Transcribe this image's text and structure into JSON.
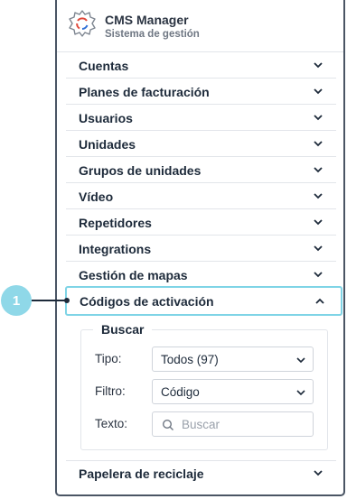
{
  "header": {
    "title": "CMS Manager",
    "subtitle": "Sistema de gestión",
    "logo_icon": "gear-logo-icon"
  },
  "menu": {
    "items": [
      {
        "label": "Cuentas"
      },
      {
        "label": "Planes de facturación"
      },
      {
        "label": "Usuarios"
      },
      {
        "label": "Unidades"
      },
      {
        "label": "Grupos de unidades"
      },
      {
        "label": "Vídeo"
      },
      {
        "label": "Repetidores"
      },
      {
        "label": "Integrations"
      },
      {
        "label": "Gestión de mapas"
      }
    ],
    "active": {
      "label": "Códigos de activación",
      "expanded": true
    },
    "after": [
      {
        "label": "Papelera de reciclaje"
      }
    ]
  },
  "search": {
    "legend": "Buscar",
    "tipo_label": "Tipo:",
    "tipo_value": "Todos (97)",
    "filtro_label": "Filtro:",
    "filtro_value": "Código",
    "texto_label": "Texto:",
    "texto_placeholder": "Buscar"
  },
  "callout": {
    "number": "1"
  },
  "colors": {
    "accent": "#7fd4e6",
    "badge": "#8fd8e8",
    "panel_border": "#4a5564",
    "text": "#1d2a3a"
  }
}
